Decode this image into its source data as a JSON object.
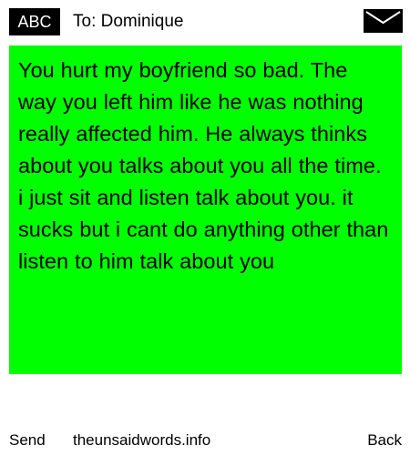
{
  "header": {
    "input_mode_badge": "ABC",
    "recipient": "To: Dominique",
    "envelope_icon": "envelope-icon"
  },
  "message": {
    "body": "You hurt my boyfriend so bad. The way you left him like he was nothing really affected him. He always thinks about you talks about you all the time. i just sit and listen talk about you. it sucks but i cant do anything other than listen to him talk about you",
    "background_color": "#00ff00"
  },
  "footer": {
    "send_label": "Send",
    "site_label": "theunsaidwords.info",
    "back_label": "Back"
  }
}
